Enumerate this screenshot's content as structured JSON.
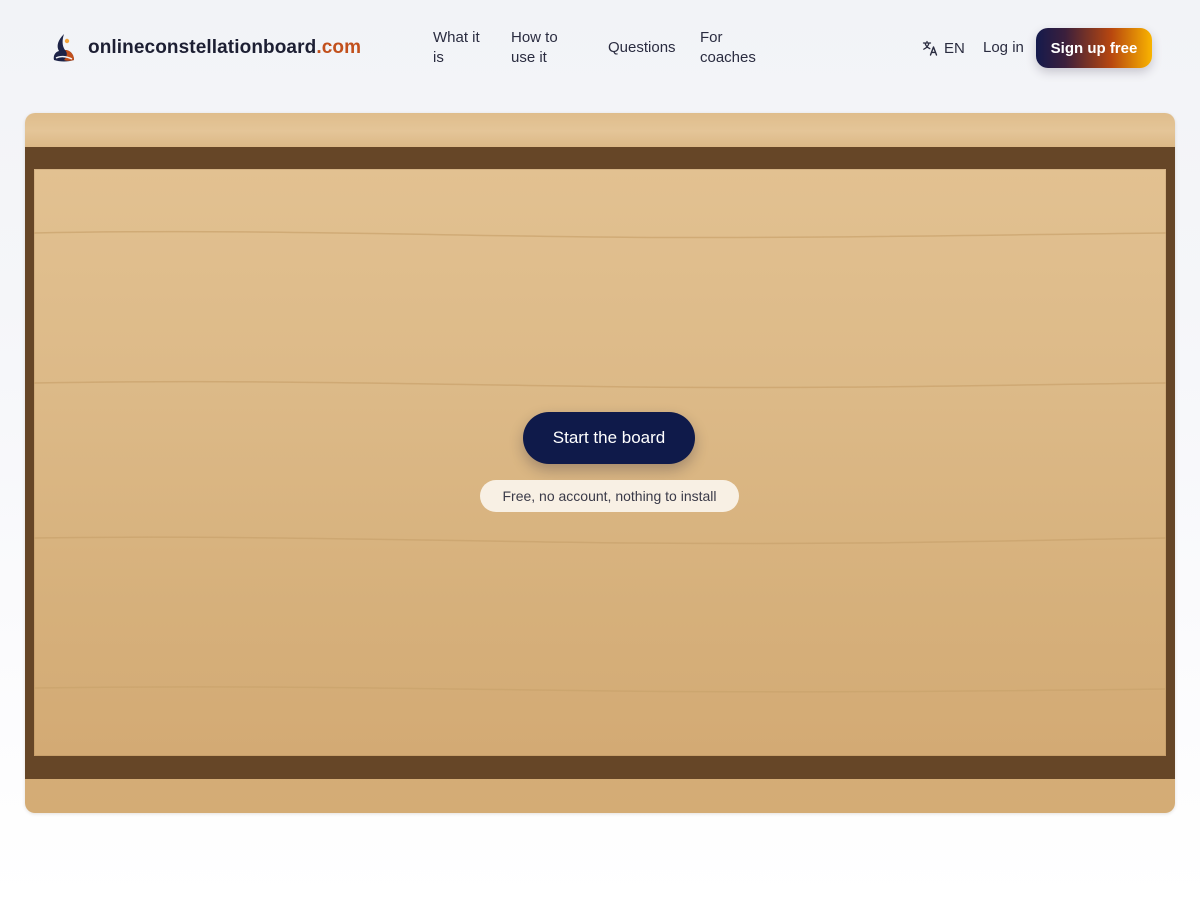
{
  "brand": {
    "name": "onlineconstellationboard",
    "tld": ".com"
  },
  "nav": {
    "items": [
      {
        "label": "What it is"
      },
      {
        "label": "How to use it"
      },
      {
        "label": "Questions"
      },
      {
        "label": "For coaches"
      }
    ]
  },
  "language": {
    "code": "EN",
    "icon": "translate-icon"
  },
  "auth": {
    "login_label": "Log in",
    "signup_label": "Sign up free"
  },
  "board": {
    "start_label": "Start the board",
    "note": "Free, no account, nothing to install"
  },
  "colors": {
    "brand_accent": "#c2501c",
    "primary_button": "#0f1a4a",
    "board_frame": "#664627",
    "board_surface": "#dcb987"
  }
}
